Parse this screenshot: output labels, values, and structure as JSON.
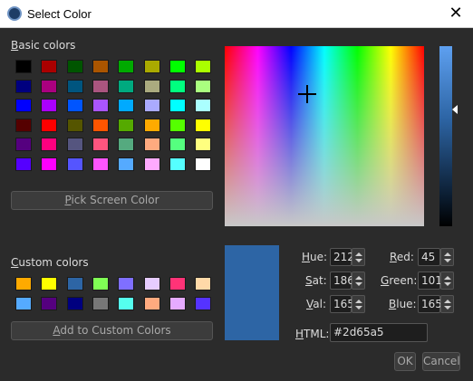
{
  "window": {
    "title": "Select Color",
    "close_glyph": "✕"
  },
  "basic_colors": {
    "label": "Basic colors",
    "swatches": [
      "#000000",
      "#aa0000",
      "#005500",
      "#aa5500",
      "#00aa00",
      "#aaaa00",
      "#00ff00",
      "#aaff00",
      "#00007f",
      "#aa007f",
      "#00557f",
      "#aa557f",
      "#00aa7f",
      "#aaaa7f",
      "#00ff7f",
      "#aaff7f",
      "#0000ff",
      "#aa00ff",
      "#0055ff",
      "#aa55ff",
      "#00aaff",
      "#aaaaff",
      "#00ffff",
      "#aaffff",
      "#550000",
      "#ff0000",
      "#555500",
      "#ff5500",
      "#55aa00",
      "#ffaa00",
      "#55ff00",
      "#ffff00",
      "#55007f",
      "#ff007f",
      "#55557f",
      "#ff557f",
      "#55aa7f",
      "#ffaa7f",
      "#55ff7f",
      "#ffff7f",
      "#5500ff",
      "#ff00ff",
      "#5555ff",
      "#ff55ff",
      "#55aaff",
      "#ffaaff",
      "#55ffff",
      "#ffffff"
    ]
  },
  "pick_screen_label": "Pick Screen Color",
  "custom_colors": {
    "label": "Custom colors",
    "swatches": [
      "#ffaa00",
      "#ffff00",
      "#2d65a5",
      "#80ff55",
      "#7f6fff",
      "#e6ccff",
      "#ff3377",
      "#ffd9a8",
      "#55aaff",
      "#55007f",
      "#00007f",
      "#777777",
      "#55ffee",
      "#ffaa7f",
      "#e6aaff",
      "#5533ff"
    ]
  },
  "add_custom_label": "Add to Custom Colors",
  "fields": {
    "hue": {
      "label": "Hue:",
      "value": "212"
    },
    "sat": {
      "label": "Sat:",
      "value": "186"
    },
    "val": {
      "label": "Val:",
      "value": "165"
    },
    "red": {
      "label": "Red:",
      "value": "45"
    },
    "green": {
      "label": "Green:",
      "value": "101"
    },
    "blue": {
      "label": "Blue:",
      "value": "165"
    },
    "html": {
      "label": "HTML:",
      "value": "#2d65a5"
    }
  },
  "current_color": "#2d65a5",
  "buttons": {
    "ok": "OK",
    "cancel": "Cancel"
  }
}
